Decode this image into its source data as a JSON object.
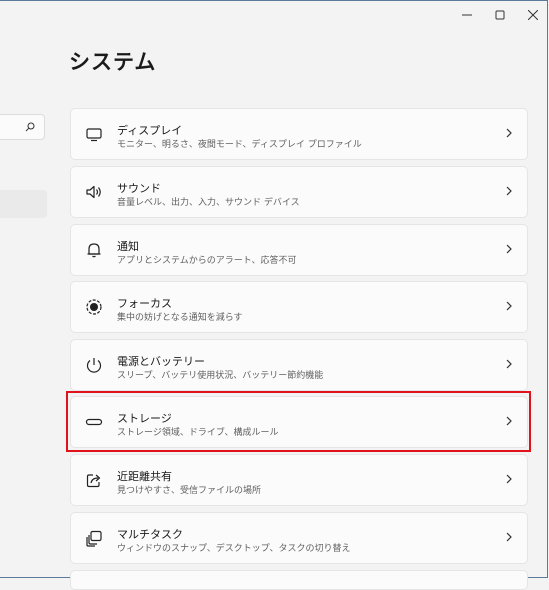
{
  "page": {
    "title": "システム"
  },
  "settings": [
    {
      "title": "ディスプレイ",
      "subtitle": "モニター、明るさ、夜間モード、ディスプレイ プロファイル",
      "icon": "monitor-icon"
    },
    {
      "title": "サウンド",
      "subtitle": "音量レベル、出力、入力、サウンド デバイス",
      "icon": "speaker-icon"
    },
    {
      "title": "通知",
      "subtitle": "アプリとシステムからのアラート、応答不可",
      "icon": "bell-icon"
    },
    {
      "title": "フォーカス",
      "subtitle": "集中の妨げとなる通知を減らす",
      "icon": "focus-icon"
    },
    {
      "title": "電源とバッテリー",
      "subtitle": "スリープ、バッテリ使用状況、バッテリー節約機能",
      "icon": "power-icon"
    },
    {
      "title": "ストレージ",
      "subtitle": "ストレージ領域、ドライブ、構成ルール",
      "icon": "storage-icon"
    },
    {
      "title": "近距離共有",
      "subtitle": "見つけやすさ、受信ファイルの場所",
      "icon": "share-icon"
    },
    {
      "title": "マルチタスク",
      "subtitle": "ウィンドウのスナップ、デスクトップ、タスクの切り替え",
      "icon": "multitask-icon"
    }
  ],
  "highlight_color": "#e0121b"
}
